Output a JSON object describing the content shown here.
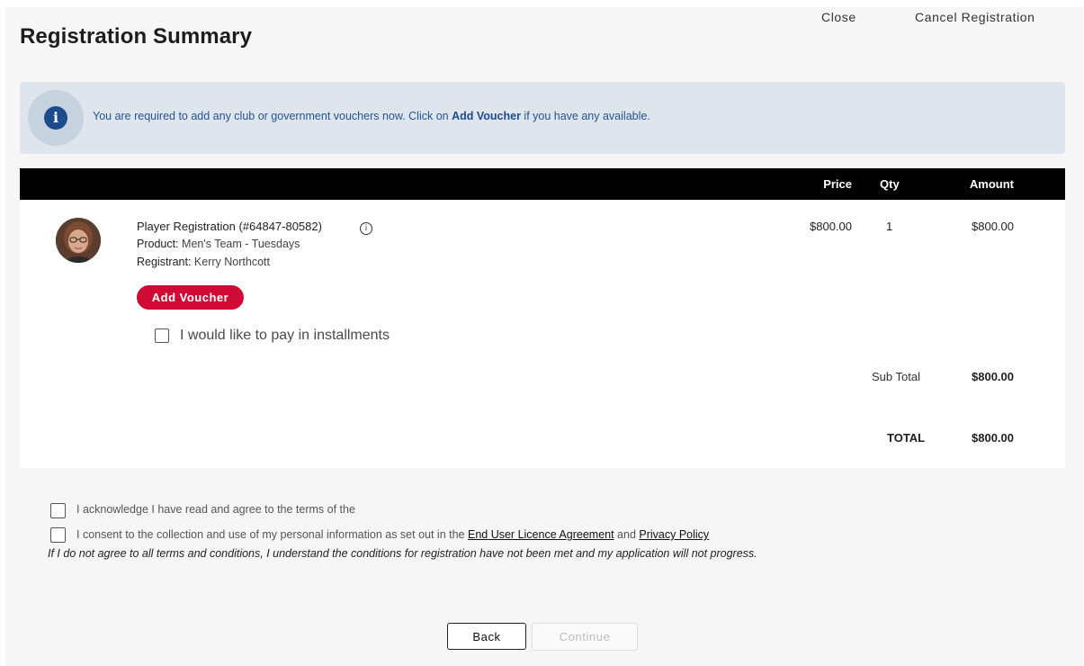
{
  "header": {
    "title": "Registration Summary",
    "close_label": "Close",
    "cancel_label": "Cancel Registration"
  },
  "notice": {
    "icon": "info-icon",
    "text_before": "You are required to add any club or government vouchers now. Click on ",
    "text_bold": "Add Voucher",
    "text_after": " if you have any available."
  },
  "table": {
    "headers": {
      "price": "Price",
      "qty": "Qty",
      "amount": "Amount"
    },
    "items": [
      {
        "title": "Player Registration (#64847-80582)",
        "product_label": "Product:",
        "product_value": " Men's Team - Tuesdays",
        "registrant_label": "Registrant:",
        "registrant_value": " Kerry Northcott",
        "price": "$800.00",
        "qty": "1",
        "amount": "$800.00"
      }
    ],
    "add_voucher_label": "Add Voucher",
    "installments_label": "I would like to pay in installments",
    "installments_checked": false,
    "subtotal_label": "Sub Total",
    "subtotal_value": "$800.00",
    "total_label": "TOTAL",
    "total_value": "$800.00"
  },
  "agreements": {
    "ack_text": "I acknowledge I have read and agree to the terms of the",
    "ack_checked": false,
    "consent_text": "I consent to the collection and use of my personal information as set out in the ",
    "eula_link": "End User Licence Agreement",
    "and_text": " and ",
    "privacy_link": "Privacy Policy",
    "consent_checked": false,
    "disclaimer": "If I do not agree to all terms and conditions, I understand the conditions for registration have not been met and my application will not progress."
  },
  "footer": {
    "back_label": "Back",
    "continue_label": "Continue",
    "continue_enabled": false
  },
  "colors": {
    "accent": "#cf0a35",
    "notice_bg": "#dfe5ed",
    "notice_text": "#24548f",
    "table_header_bg": "#000000"
  }
}
